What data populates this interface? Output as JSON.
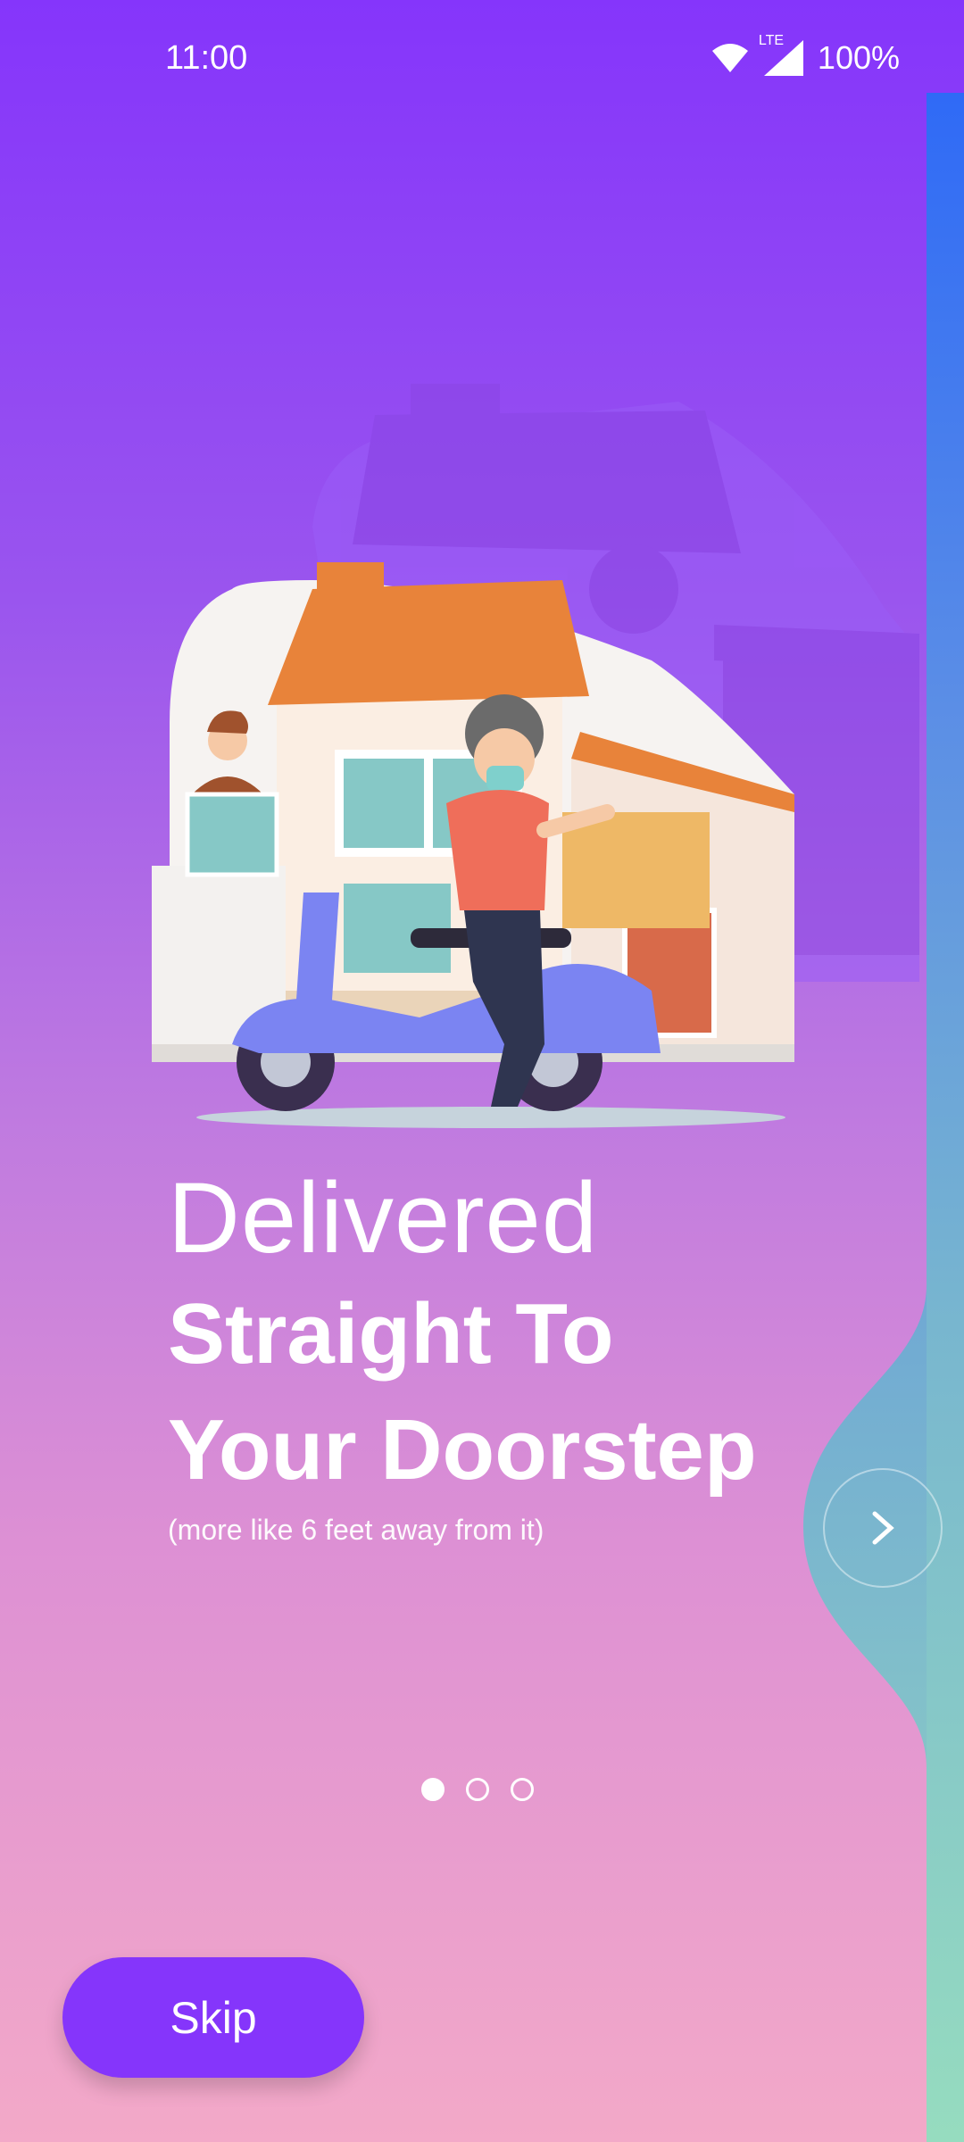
{
  "status_bar": {
    "time": "11:00",
    "network_label": "LTE",
    "battery_text": "100%",
    "icons": [
      "wifi-icon",
      "signal-icon"
    ]
  },
  "onboarding": {
    "headline_line1": "Delivered",
    "headline_line2": "Straight To",
    "headline_line3": "Your Doorstep",
    "subtext": "(more like 6 feet away from it)",
    "page_indicator": {
      "current": 1,
      "total": 3
    },
    "next_button_icon": "chevron-right-icon",
    "skip_label": "Skip"
  },
  "colors": {
    "primary": "#8535fb",
    "strip_top": "#2f6af6",
    "strip_bottom": "#96dcbf",
    "house_roof": "#e8833a",
    "scooter": "#7b84f2",
    "box": "#eeb866"
  }
}
